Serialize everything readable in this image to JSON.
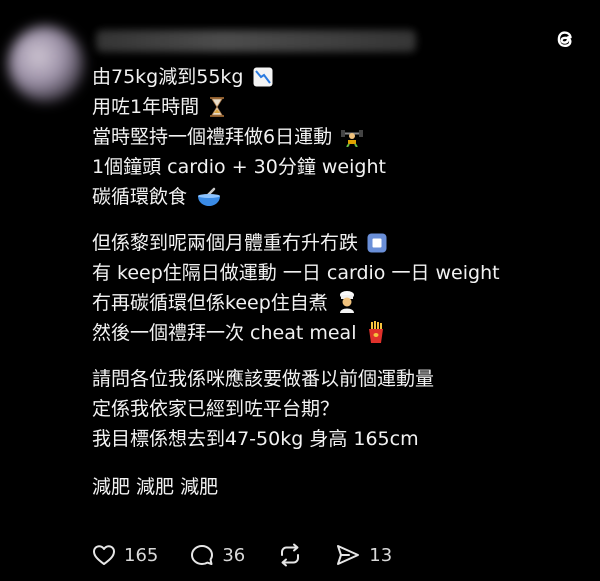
{
  "post": {
    "lines_block1": [
      "由75kg減到55kg",
      "用咗1年時間",
      "當時堅持一個禮拜做6日運動",
      "1個鐘頭 cardio + 30分鐘 weight",
      "碳循環飲食"
    ],
    "lines_block2": [
      "但係黎到呢兩個月體重冇升冇跌",
      "有 keep住隔日做運動 一日 cardio 一日 weight",
      "冇再碳循環但係keep住自煮",
      "然後一個禮拜一次 cheat meal"
    ],
    "lines_block3": [
      "請問各位我係咪應該要做番以前個運動量",
      "定係我依家已經到咗平台期？",
      "我目標係想去到47-50kg 身高 165cm"
    ],
    "hashtags_line": "減肥 減肥 減肥",
    "emoji_icons": [
      "chart-decreasing-icon",
      "hourglass-icon",
      "weightlifter-icon",
      "bowl-spoon-icon",
      "stop-button-icon",
      "cook-icon",
      "fries-icon"
    ]
  },
  "actions": {
    "likes": "165",
    "replies": "36",
    "shares": "13"
  }
}
